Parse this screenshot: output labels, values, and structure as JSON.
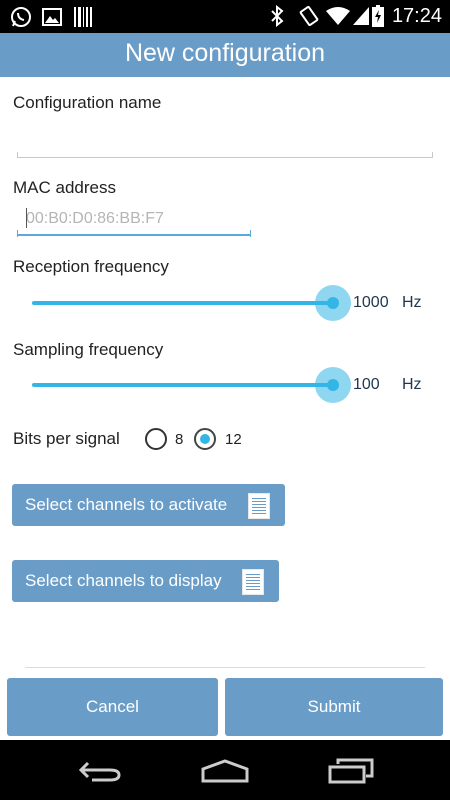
{
  "status_bar": {
    "time": "17:24",
    "icons": [
      "whatsapp-icon",
      "gallery-icon",
      "barcode-icon",
      "bluetooth-icon",
      "rotate-icon",
      "wifi-icon",
      "signal-icon",
      "battery-icon"
    ]
  },
  "action_bar": {
    "title": "New configuration"
  },
  "form": {
    "config_name": {
      "label": "Configuration name",
      "value": ""
    },
    "mac": {
      "label": "MAC address",
      "placeholder": "00:B0:D0:86:BB:F7",
      "value": ""
    },
    "reception": {
      "label": "Reception frequency",
      "value": "1000",
      "unit": "Hz",
      "fraction": 1.0
    },
    "sampling": {
      "label": "Sampling frequency",
      "value": "100",
      "unit": "Hz",
      "fraction": 1.0
    },
    "bits": {
      "label": "Bits per signal",
      "options": [
        "8",
        "12"
      ],
      "selected": "12"
    }
  },
  "buttons": {
    "activate": "Select channels to activate",
    "display": "Select channels to display",
    "cancel": "Cancel",
    "submit": "Submit"
  },
  "colors": {
    "accent": "#33b5e5",
    "primary": "#6a9cc8",
    "statusbar": "#000000"
  },
  "navigation": {
    "icons": [
      "back-icon",
      "home-icon",
      "recents-icon"
    ]
  }
}
